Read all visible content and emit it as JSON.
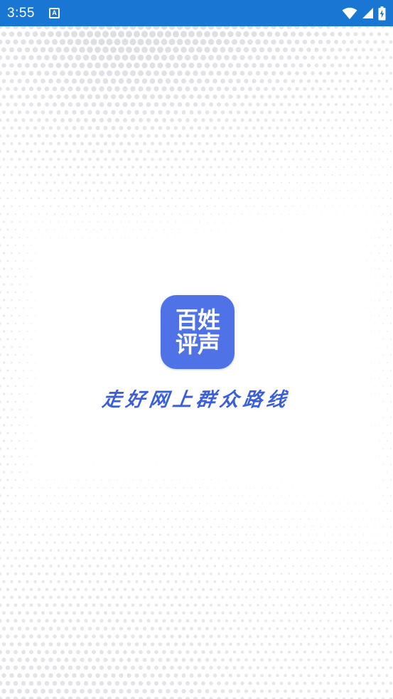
{
  "status_bar": {
    "time": "3:55",
    "notification_letter": "A",
    "background_color": "#1976d2",
    "icons": [
      "wifi-icon",
      "cellular-signal-icon",
      "battery-charging-icon"
    ]
  },
  "splash": {
    "logo": {
      "line1": "百姓",
      "line2": "评声",
      "background_color": "#4f72e6"
    },
    "slogan": "走好网上群众路线",
    "slogan_color": "#3a5fd8"
  }
}
